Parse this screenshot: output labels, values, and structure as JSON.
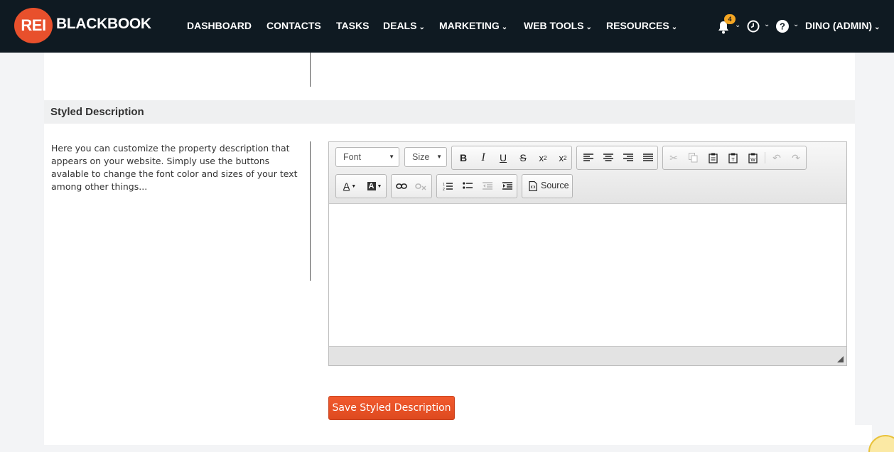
{
  "brand": {
    "badge": "REI",
    "name": "BLACKBOOK"
  },
  "nav": {
    "items": [
      {
        "label": "DASHBOARD"
      },
      {
        "label": "CONTACTS"
      },
      {
        "label": "TASKS"
      },
      {
        "label": "DEALS"
      },
      {
        "label": "MARKETING"
      },
      {
        "label": "WEB TOOLS"
      },
      {
        "label": "RESOURCES"
      }
    ],
    "notifications_count": "4",
    "user": "DINO (ADMIN)"
  },
  "section": {
    "title": "Styled Description",
    "help_text": "Here you can customize the property description that appears on your website. Simply use the buttons avalable to change the font color and sizes of your text among other things..."
  },
  "editor": {
    "font_label": "Font",
    "size_label": "Size",
    "source_label": "Source",
    "content": ""
  },
  "save_label": "Save Styled Description",
  "colors": {
    "nav_bg": "#0f1a22",
    "accent": "#e8502c",
    "badge": "#f5a623"
  }
}
